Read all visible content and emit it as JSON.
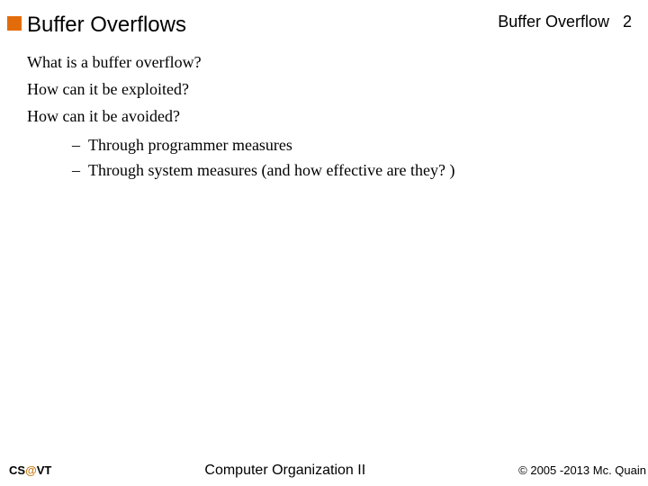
{
  "header": {
    "title": "Buffer Overflows",
    "right_label": "Buffer Overflow",
    "page_number": "2"
  },
  "body": {
    "q1": "What is a buffer overflow?",
    "q2": "How can it be exploited?",
    "q3": "How can it be avoided?",
    "sub": [
      {
        "dash": "–",
        "text": "Through programmer measures"
      },
      {
        "dash": "–",
        "text": "Through system measures (and how effective are they? )"
      }
    ]
  },
  "footer": {
    "left_cs": "CS",
    "left_at": "@",
    "left_vt": "VT",
    "center": "Computer Organization II",
    "right": "© 2005 -2013 Mc. Quain"
  }
}
